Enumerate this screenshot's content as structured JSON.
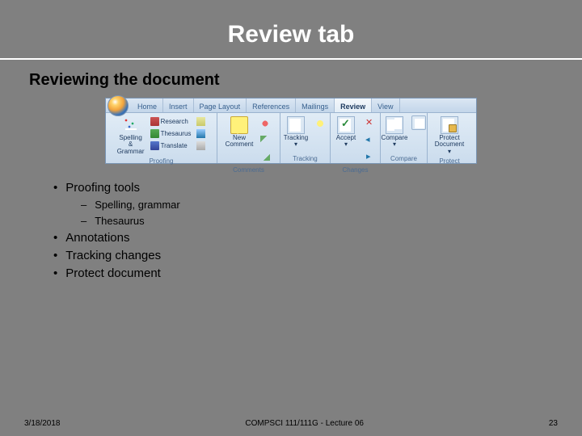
{
  "slide": {
    "title": "Review tab",
    "subtitle": "Reviewing the document"
  },
  "ribbon": {
    "tabs": [
      "Home",
      "Insert",
      "Page Layout",
      "References",
      "Mailings",
      "Review",
      "View"
    ],
    "active_tab": "Review",
    "groups": {
      "proofing": {
        "label": "Proofing",
        "spelling": "Spelling & Grammar",
        "research": "Research",
        "thesaurus": "Thesaurus",
        "translate": "Translate",
        "update": "",
        "language": "",
        "wordcount": ""
      },
      "comments": {
        "label": "Comments",
        "new": "New Comment"
      },
      "tracking": {
        "label": "Tracking",
        "track": "Track Changes",
        "balloons": ""
      },
      "changes": {
        "label": "Changes",
        "accept": "Accept"
      },
      "compare": {
        "label": "Compare",
        "compare": "Compare"
      },
      "protect": {
        "label": "Protect",
        "protect": "Protect Document"
      }
    }
  },
  "bullets": {
    "b1": "Proofing tools",
    "b1a": "Spelling, grammar",
    "b1b": "Thesaurus",
    "b2": "Annotations",
    "b3": "Tracking changes",
    "b4": "Protect document"
  },
  "footer": {
    "date": "3/18/2018",
    "course": "COMPSCI 111/111G - Lecture 06",
    "page": "23"
  }
}
